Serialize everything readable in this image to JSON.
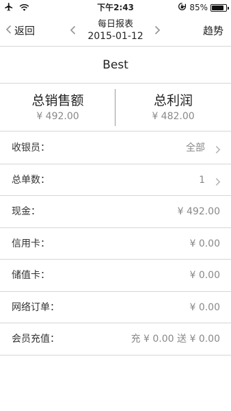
{
  "status_bar": {
    "time": "下午2:43",
    "battery": "85%",
    "battery_level": 0.85,
    "icons": [
      "airplane-icon",
      "wifi-icon",
      "rotation-lock-icon",
      "battery-icon"
    ]
  },
  "navbar": {
    "back_label": "返回",
    "title": "每日报表",
    "date": "2015-01-12",
    "trend_label": "趋势"
  },
  "store": {
    "name": "Best"
  },
  "summary": {
    "sales_label": "总销售额",
    "sales_value": "¥ 492.00",
    "profit_label": "总利润",
    "profit_value": "¥ 482.00"
  },
  "rows": [
    {
      "label": "收银员：",
      "value": "全部"
    },
    {
      "label": "总单数：",
      "value": "1"
    },
    {
      "label": "现金：",
      "value": "¥ 492.00"
    },
    {
      "label": "信用卡：",
      "value": "¥ 0.00"
    },
    {
      "label": "储值卡：",
      "value": "¥ 0.00"
    },
    {
      "label": "网络订单：",
      "value": "¥ 0.00"
    },
    {
      "label": "会员充值：",
      "value": "充 ¥ 0.00 送 ¥ 0.00"
    }
  ],
  "colors": {
    "text": "#222222",
    "secondary_text": "#888888",
    "divider": "#d6d6d6",
    "background": "#ffffff"
  }
}
